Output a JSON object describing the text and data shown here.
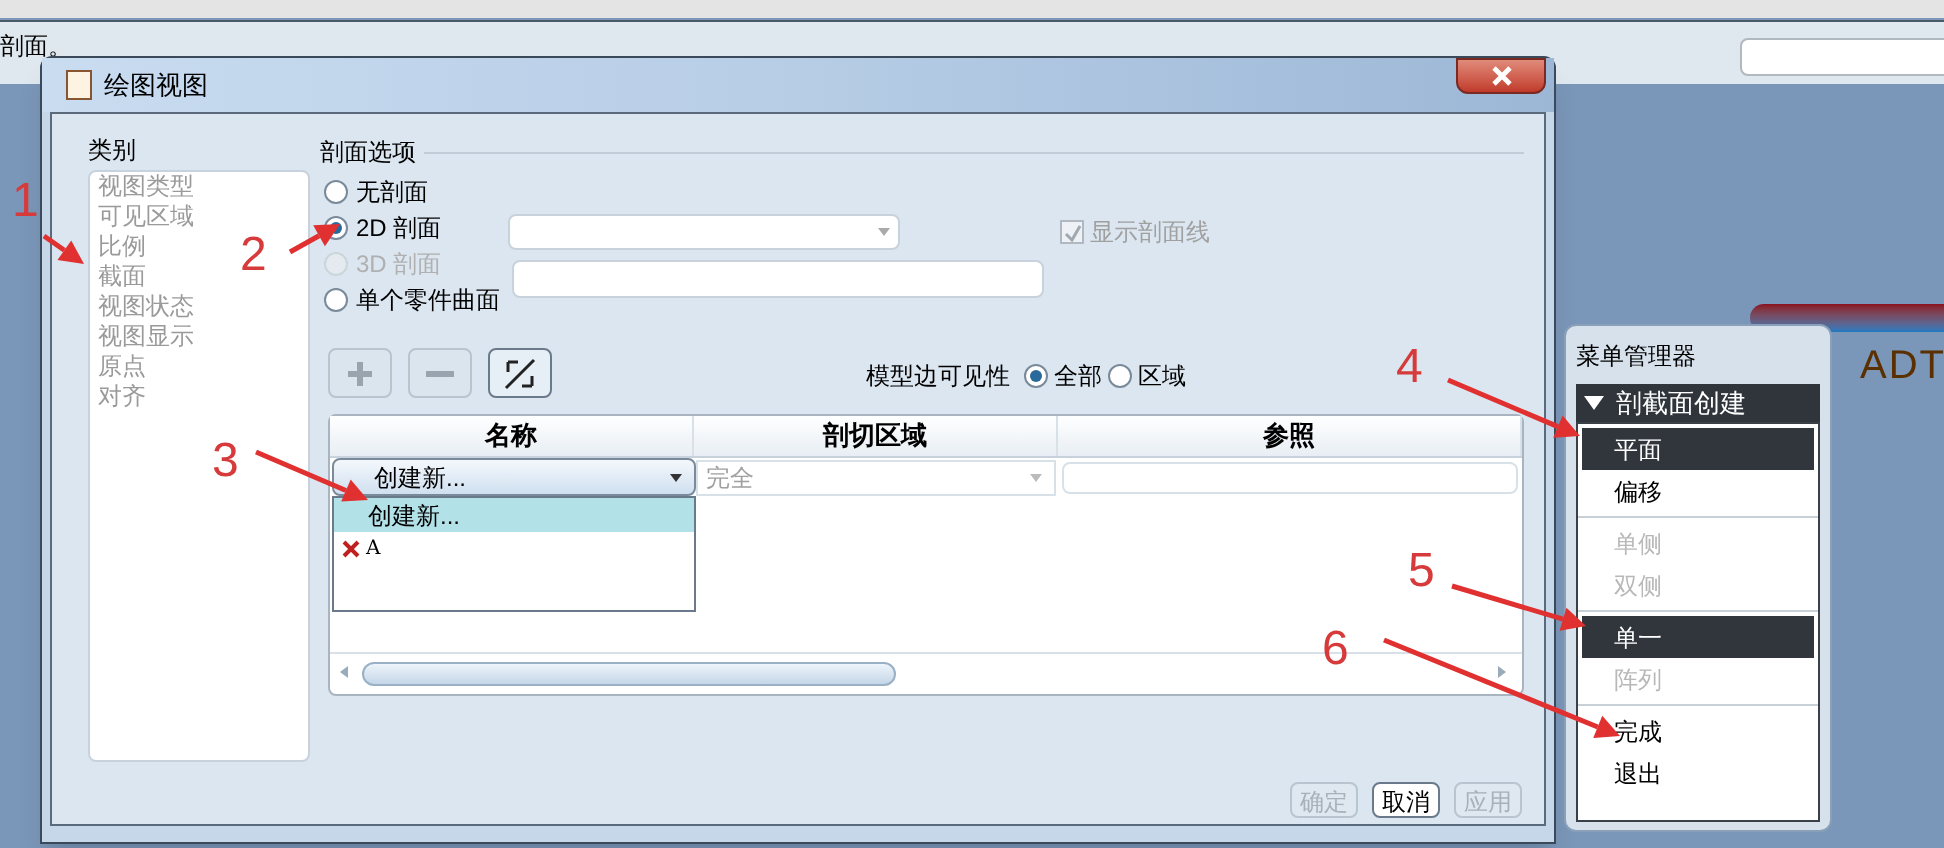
{
  "app": {
    "status_text": "剖面。",
    "canvas_text": "ADT"
  },
  "dialog": {
    "title": "绘图视图",
    "categories_label": "类别",
    "categories": [
      "视图类型",
      "可见区域",
      "比例",
      "截面",
      "视图状态",
      "视图显示",
      "原点",
      "对齐"
    ],
    "section_options": {
      "label": "剖面选项",
      "radios": [
        {
          "label": "无剖面",
          "selected": false,
          "disabled": false
        },
        {
          "label": "2D 剖面",
          "selected": true,
          "disabled": false
        },
        {
          "label": "3D 剖面",
          "selected": false,
          "disabled": true
        },
        {
          "label": "单个零件曲面",
          "selected": false,
          "disabled": false
        }
      ],
      "show_hatching": {
        "label": "显示剖面线",
        "checked": true,
        "disabled": true
      }
    },
    "visibility": {
      "label": "模型边可见性",
      "options": [
        {
          "label": "全部",
          "selected": true
        },
        {
          "label": "区域",
          "selected": false
        }
      ]
    },
    "table": {
      "columns": [
        "名称",
        "剖切区域",
        "参照"
      ],
      "row": {
        "name": "创建新...",
        "region": "完全"
      },
      "dropdown": [
        {
          "label": "创建新...",
          "selected": true,
          "invalid": false
        },
        {
          "label": "A",
          "selected": false,
          "invalid": true
        }
      ]
    },
    "buttons": [
      {
        "label": "确定",
        "disabled": true
      },
      {
        "label": "取消",
        "disabled": false
      },
      {
        "label": "应用",
        "disabled": true
      }
    ]
  },
  "menu_manager": {
    "title": "菜单管理器",
    "section": "剖截面创建",
    "groups": [
      [
        {
          "label": "平面",
          "selected": true,
          "disabled": false
        },
        {
          "label": "偏移",
          "selected": false,
          "disabled": false
        }
      ],
      [
        {
          "label": "单侧",
          "selected": false,
          "disabled": true
        },
        {
          "label": "双侧",
          "selected": false,
          "disabled": true
        }
      ],
      [
        {
          "label": "单一",
          "selected": true,
          "disabled": false
        },
        {
          "label": "阵列",
          "selected": false,
          "disabled": true
        }
      ],
      [
        {
          "label": "完成",
          "selected": false,
          "disabled": false
        },
        {
          "label": "退出",
          "selected": false,
          "disabled": false
        }
      ]
    ]
  },
  "annotations": [
    "1",
    "2",
    "3",
    "4",
    "5",
    "6"
  ]
}
